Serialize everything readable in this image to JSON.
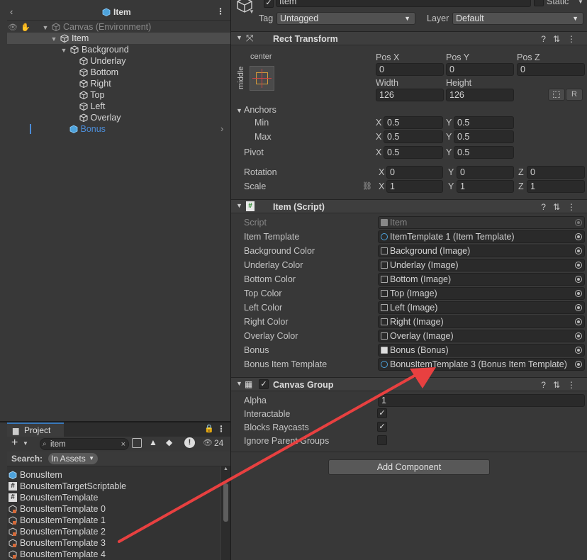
{
  "hierarchy": {
    "title": "Item",
    "rows": [
      {
        "label": "Canvas (Environment)",
        "depth": 0
      },
      {
        "label": "Item",
        "depth": 1
      },
      {
        "label": "Background",
        "depth": 2
      },
      {
        "label": "Underlay",
        "depth": 3
      },
      {
        "label": "Bottom",
        "depth": 3
      },
      {
        "label": "Right",
        "depth": 3
      },
      {
        "label": "Top",
        "depth": 3
      },
      {
        "label": "Left",
        "depth": 3
      },
      {
        "label": "Overlay",
        "depth": 3
      },
      {
        "label": "Bonus",
        "depth": 2
      }
    ]
  },
  "project": {
    "tab": "Project",
    "search_value": "item",
    "search_label": "Search:",
    "scope": "In Assets",
    "hidden_count": "24",
    "items": [
      "BonusItem",
      "BonusItemTargetScriptable",
      "BonusItemTemplate",
      "BonusItemTemplate 0",
      "BonusItemTemplate 1",
      "BonusItemTemplate 2",
      "BonusItemTemplate 3",
      "BonusItemTemplate 4"
    ]
  },
  "inspector": {
    "object_name": "Item",
    "static_label": "Static",
    "tag_label": "Tag",
    "tag_value": "Untagged",
    "layer_label": "Layer",
    "layer_value": "Default",
    "rect": {
      "title": "Rect Transform",
      "anchor_h": "center",
      "anchor_v": "middle",
      "posx_label": "Pos X",
      "posx": "0",
      "posy_label": "Pos Y",
      "posy": "0",
      "posz_label": "Pos Z",
      "posz": "0",
      "width_label": "Width",
      "width": "126",
      "height_label": "Height",
      "height": "126",
      "r_btn": "R",
      "anchors_label": "Anchors",
      "min_label": "Min",
      "min_x": "0.5",
      "min_y": "0.5",
      "max_label": "Max",
      "max_x": "0.5",
      "max_y": "0.5",
      "pivot_label": "Pivot",
      "pivot_x": "0.5",
      "pivot_y": "0.5",
      "rotation_label": "Rotation",
      "rot_x": "0",
      "rot_y": "0",
      "rot_z": "0",
      "scale_label": "Scale",
      "scale_x": "1",
      "scale_y": "1",
      "scale_z": "1",
      "x": "X",
      "y": "Y",
      "z": "Z"
    },
    "script": {
      "title": "Item (Script)",
      "fields": [
        {
          "label": "Script",
          "value": "Item"
        },
        {
          "label": "Item Template",
          "value": "ItemTemplate 1 (Item Template)"
        },
        {
          "label": "Background Color",
          "value": "Background (Image)"
        },
        {
          "label": "Underlay Color",
          "value": "Underlay (Image)"
        },
        {
          "label": "Bottom Color",
          "value": "Bottom (Image)"
        },
        {
          "label": "Top Color",
          "value": "Top (Image)"
        },
        {
          "label": "Left Color",
          "value": "Left (Image)"
        },
        {
          "label": "Right Color",
          "value": "Right (Image)"
        },
        {
          "label": "Overlay Color",
          "value": "Overlay (Image)"
        },
        {
          "label": "Bonus",
          "value": "Bonus (Bonus)"
        },
        {
          "label": "Bonus Item Template",
          "value": "BonusItemTemplate 3 (Bonus Item Template)"
        }
      ]
    },
    "canvas_group": {
      "title": "Canvas Group",
      "alpha_label": "Alpha",
      "alpha": "1",
      "interactable_label": "Interactable",
      "blocks_label": "Blocks Raycasts",
      "ignore_label": "Ignore Parent Groups"
    },
    "add_component": "Add Component"
  },
  "colors": {
    "arrow": "#e84040",
    "selected_row": "#4d4d4d",
    "bonus_text": "#4c8cd6"
  }
}
